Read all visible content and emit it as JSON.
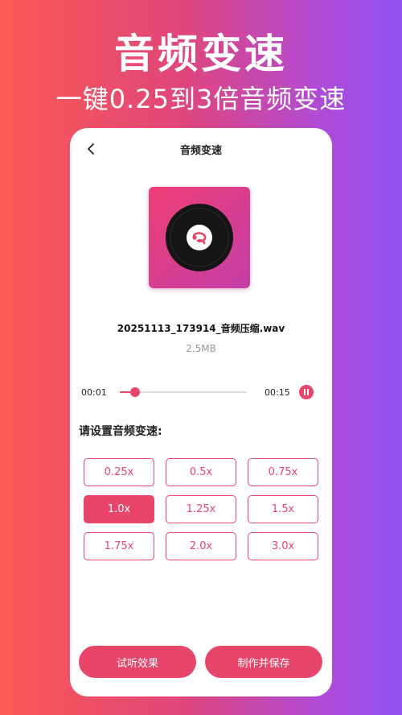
{
  "hero": {
    "title": "音频变速",
    "subtitle": "一键0.25到3倍音频变速"
  },
  "screen": {
    "title": "音频变速",
    "back_icon": "chevron-left-icon"
  },
  "cover": {
    "icon": "vinyl-record-icon",
    "gradient_start": "#ef3f74",
    "gradient_end": "#c33ea8"
  },
  "file": {
    "name": "20251113_173914_音频压缩.wav",
    "size": "2.5MB"
  },
  "player": {
    "current_time": "00:01",
    "total_time": "00:15",
    "progress": 0.12,
    "control_icon": "pause-icon"
  },
  "speed": {
    "label": "请设置音频变速:",
    "options": [
      "0.25x",
      "0.5x",
      "0.75x",
      "1.0x",
      "1.25x",
      "1.5x",
      "1.75x",
      "2.0x",
      "3.0x"
    ],
    "selected": "1.0x"
  },
  "actions": {
    "preview_label": "试听效果",
    "save_label": "制作并保存"
  },
  "colors": {
    "accent": "#e8456a",
    "bg_left": "#fb5a52",
    "bg_right": "#8f52f4"
  }
}
